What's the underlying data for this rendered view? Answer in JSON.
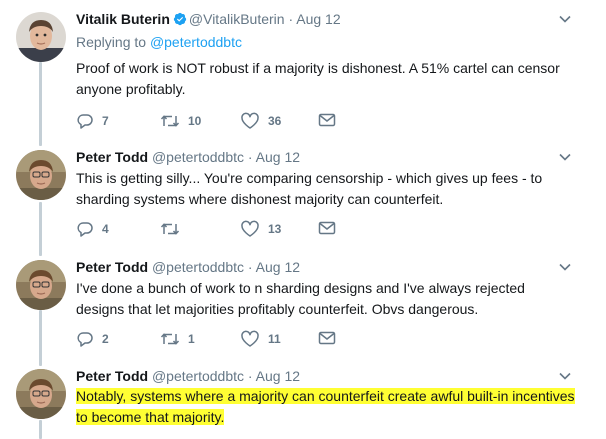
{
  "tweets": [
    {
      "name": "Vitalik Buterin",
      "handle": "@VitalikButerin",
      "date": "· Aug 12",
      "replying_prefix": "Replying to ",
      "replying_handle": "@petertoddbtc",
      "text": "Proof of work is NOT robust if a majority is dishonest. A 51% cartel can censor anyone profitably.",
      "replies": "7",
      "retweets": "10",
      "likes": "36"
    },
    {
      "name": "Peter Todd",
      "handle": "@petertoddbtc",
      "date": "· Aug 12",
      "text": "This is getting silly... You're comparing censorship - which gives up fees - to sharding systems where dishonest majority can counterfeit.",
      "replies": "4",
      "retweets": "",
      "likes": "13"
    },
    {
      "name": "Peter Todd",
      "handle": "@petertoddbtc",
      "date": "· Aug 12",
      "text": "I've done a bunch of work to n sharding designs and I've always rejected designs that let majorities profitably counterfeit. Obvs dangerous.",
      "replies": "2",
      "retweets": "1",
      "likes": "11"
    },
    {
      "name": "Peter Todd",
      "handle": "@petertoddbtc",
      "date": "· Aug 12",
      "text_line1": "Notably, systems where a majority can counterfeit create awful built-in incentives",
      "text_line2": "to become that majority."
    }
  ],
  "colors": {
    "highlight": "#ffff33",
    "link": "#1da1f2",
    "muted": "#657786",
    "thread": "#c4cfd6"
  }
}
